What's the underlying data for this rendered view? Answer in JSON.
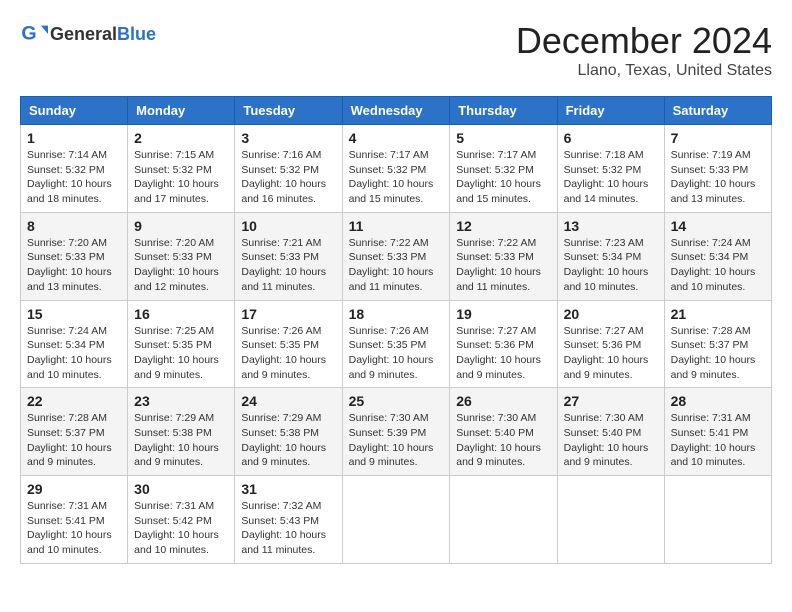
{
  "header": {
    "logo_general": "General",
    "logo_blue": "Blue",
    "month_title": "December 2024",
    "location": "Llano, Texas, United States"
  },
  "calendar": {
    "days_of_week": [
      "Sunday",
      "Monday",
      "Tuesday",
      "Wednesday",
      "Thursday",
      "Friday",
      "Saturday"
    ],
    "weeks": [
      [
        null,
        null,
        null,
        null,
        null,
        null,
        null
      ]
    ],
    "cells": [
      {
        "date": 1,
        "dow": 0,
        "sunrise": "7:14 AM",
        "sunset": "5:32 PM",
        "daylight": "10 hours and 18 minutes."
      },
      {
        "date": 2,
        "dow": 1,
        "sunrise": "7:15 AM",
        "sunset": "5:32 PM",
        "daylight": "10 hours and 17 minutes."
      },
      {
        "date": 3,
        "dow": 2,
        "sunrise": "7:16 AM",
        "sunset": "5:32 PM",
        "daylight": "10 hours and 16 minutes."
      },
      {
        "date": 4,
        "dow": 3,
        "sunrise": "7:17 AM",
        "sunset": "5:32 PM",
        "daylight": "10 hours and 15 minutes."
      },
      {
        "date": 5,
        "dow": 4,
        "sunrise": "7:17 AM",
        "sunset": "5:32 PM",
        "daylight": "10 hours and 15 minutes."
      },
      {
        "date": 6,
        "dow": 5,
        "sunrise": "7:18 AM",
        "sunset": "5:32 PM",
        "daylight": "10 hours and 14 minutes."
      },
      {
        "date": 7,
        "dow": 6,
        "sunrise": "7:19 AM",
        "sunset": "5:33 PM",
        "daylight": "10 hours and 13 minutes."
      },
      {
        "date": 8,
        "dow": 0,
        "sunrise": "7:20 AM",
        "sunset": "5:33 PM",
        "daylight": "10 hours and 13 minutes."
      },
      {
        "date": 9,
        "dow": 1,
        "sunrise": "7:20 AM",
        "sunset": "5:33 PM",
        "daylight": "10 hours and 12 minutes."
      },
      {
        "date": 10,
        "dow": 2,
        "sunrise": "7:21 AM",
        "sunset": "5:33 PM",
        "daylight": "10 hours and 11 minutes."
      },
      {
        "date": 11,
        "dow": 3,
        "sunrise": "7:22 AM",
        "sunset": "5:33 PM",
        "daylight": "10 hours and 11 minutes."
      },
      {
        "date": 12,
        "dow": 4,
        "sunrise": "7:22 AM",
        "sunset": "5:33 PM",
        "daylight": "10 hours and 11 minutes."
      },
      {
        "date": 13,
        "dow": 5,
        "sunrise": "7:23 AM",
        "sunset": "5:34 PM",
        "daylight": "10 hours and 10 minutes."
      },
      {
        "date": 14,
        "dow": 6,
        "sunrise": "7:24 AM",
        "sunset": "5:34 PM",
        "daylight": "10 hours and 10 minutes."
      },
      {
        "date": 15,
        "dow": 0,
        "sunrise": "7:24 AM",
        "sunset": "5:34 PM",
        "daylight": "10 hours and 10 minutes."
      },
      {
        "date": 16,
        "dow": 1,
        "sunrise": "7:25 AM",
        "sunset": "5:35 PM",
        "daylight": "10 hours and 9 minutes."
      },
      {
        "date": 17,
        "dow": 2,
        "sunrise": "7:26 AM",
        "sunset": "5:35 PM",
        "daylight": "10 hours and 9 minutes."
      },
      {
        "date": 18,
        "dow": 3,
        "sunrise": "7:26 AM",
        "sunset": "5:35 PM",
        "daylight": "10 hours and 9 minutes."
      },
      {
        "date": 19,
        "dow": 4,
        "sunrise": "7:27 AM",
        "sunset": "5:36 PM",
        "daylight": "10 hours and 9 minutes."
      },
      {
        "date": 20,
        "dow": 5,
        "sunrise": "7:27 AM",
        "sunset": "5:36 PM",
        "daylight": "10 hours and 9 minutes."
      },
      {
        "date": 21,
        "dow": 6,
        "sunrise": "7:28 AM",
        "sunset": "5:37 PM",
        "daylight": "10 hours and 9 minutes."
      },
      {
        "date": 22,
        "dow": 0,
        "sunrise": "7:28 AM",
        "sunset": "5:37 PM",
        "daylight": "10 hours and 9 minutes."
      },
      {
        "date": 23,
        "dow": 1,
        "sunrise": "7:29 AM",
        "sunset": "5:38 PM",
        "daylight": "10 hours and 9 minutes."
      },
      {
        "date": 24,
        "dow": 2,
        "sunrise": "7:29 AM",
        "sunset": "5:38 PM",
        "daylight": "10 hours and 9 minutes."
      },
      {
        "date": 25,
        "dow": 3,
        "sunrise": "7:30 AM",
        "sunset": "5:39 PM",
        "daylight": "10 hours and 9 minutes."
      },
      {
        "date": 26,
        "dow": 4,
        "sunrise": "7:30 AM",
        "sunset": "5:40 PM",
        "daylight": "10 hours and 9 minutes."
      },
      {
        "date": 27,
        "dow": 5,
        "sunrise": "7:30 AM",
        "sunset": "5:40 PM",
        "daylight": "10 hours and 9 minutes."
      },
      {
        "date": 28,
        "dow": 6,
        "sunrise": "7:31 AM",
        "sunset": "5:41 PM",
        "daylight": "10 hours and 10 minutes."
      },
      {
        "date": 29,
        "dow": 0,
        "sunrise": "7:31 AM",
        "sunset": "5:41 PM",
        "daylight": "10 hours and 10 minutes."
      },
      {
        "date": 30,
        "dow": 1,
        "sunrise": "7:31 AM",
        "sunset": "5:42 PM",
        "daylight": "10 hours and 10 minutes."
      },
      {
        "date": 31,
        "dow": 2,
        "sunrise": "7:32 AM",
        "sunset": "5:43 PM",
        "daylight": "10 hours and 11 minutes."
      }
    ],
    "labels": {
      "sunrise": "Sunrise:",
      "sunset": "Sunset:",
      "daylight": "Daylight:"
    }
  }
}
